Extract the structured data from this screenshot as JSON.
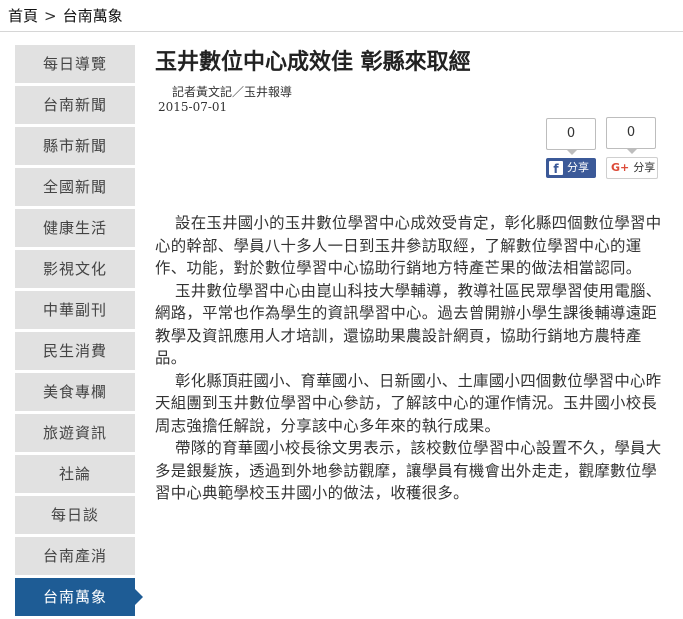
{
  "breadcrumb": {
    "home": "首頁",
    "separator": ">",
    "current": "台南萬象"
  },
  "sidebar": {
    "items": [
      {
        "label": "每日導覽"
      },
      {
        "label": "台南新聞"
      },
      {
        "label": "縣市新聞"
      },
      {
        "label": "全國新聞"
      },
      {
        "label": "健康生活"
      },
      {
        "label": "影視文化"
      },
      {
        "label": "中華副刊"
      },
      {
        "label": "民生消費"
      },
      {
        "label": "美食專欄"
      },
      {
        "label": "旅遊資訊"
      },
      {
        "label": "社論"
      },
      {
        "label": "每日談"
      },
      {
        "label": "台南產消"
      },
      {
        "label": "台南萬象",
        "active": true
      }
    ]
  },
  "article": {
    "title": "玉井數位中心成效佳 彰縣來取經",
    "reporter": "記者黃文記／玉井報導",
    "date": "2015-07-01",
    "paragraphs": [
      "設在玉井國小的玉井數位學習中心成效受肯定，彰化縣四個數位學習中心的幹部、學員八十多人一日到玉井參訪取經，了解數位學習中心的運作、功能，對於數位學習中心協助行銷地方特產芒果的做法相當認同。",
      "玉井數位學習中心由崑山科技大學輔導，教導社區民眾學習使用電腦、網路，平常也作為學生的資訊學習中心。過去曾開辦小學生課後輔導遠距教學及資訊應用人才培訓，還協助果農設計網頁，協助行銷地方農特產品。",
      "彰化縣頂莊國小、育華國小、日新國小、土庫國小四個數位學習中心昨天組團到玉井數位學習中心參訪，了解該中心的運作情況。玉井國小校長周志強擔任解說，分享該中心多年來的執行成果。",
      "帶隊的育華國小校長徐文男表示，該校數位學習中心設置不久，學員大多是銀髮族，透過到外地參訪觀摩，讓學員有機會出外走走，觀摩數位學習中心典範學校玉井國小的做法，收穫很多。"
    ]
  },
  "share": {
    "facebook": {
      "count": "0",
      "label": "分享",
      "icon": "f"
    },
    "googleplus": {
      "count": "0",
      "label": "分享",
      "icon": "G+"
    }
  },
  "colors": {
    "sidebar_bg": "#e1e1e1",
    "sidebar_active": "#1e5c95",
    "facebook": "#3b5998",
    "googleplus": "#dd4b39"
  }
}
